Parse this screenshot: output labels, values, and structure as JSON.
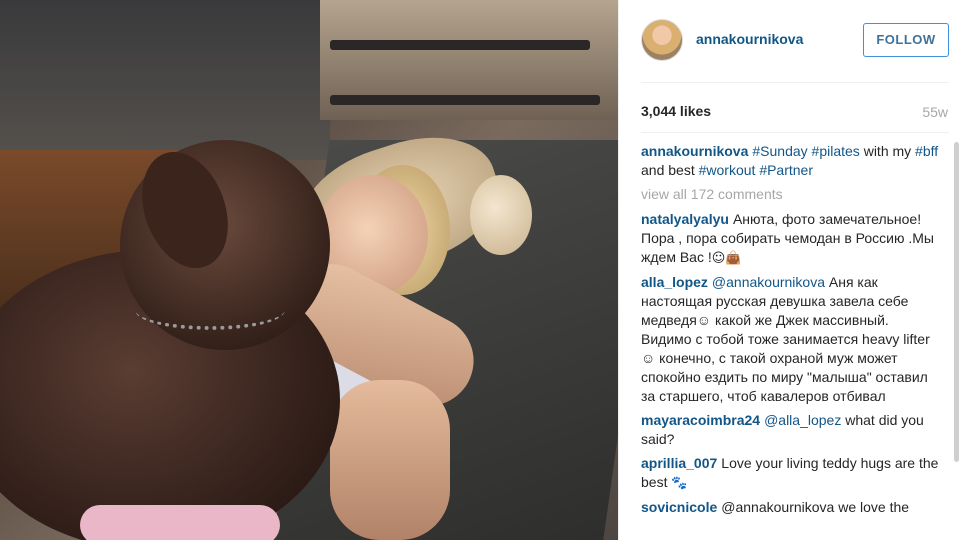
{
  "post": {
    "username": "annakournikova",
    "follow_label": "FOLLOW",
    "likes": "3,044 likes",
    "age": "55w",
    "caption": {
      "user": "annakournikova",
      "parts": [
        "#Sunday",
        " ",
        "#pilates",
        " with my ",
        "#bff",
        " and best ",
        "#workout",
        " ",
        "#Partner"
      ]
    },
    "view_all": "view all 172 comments"
  },
  "comments": [
    {
      "user": "natalyalyalyu",
      "text": "Анюта, фото замечательное! Пора , пора собирать чемодан в Россию .Мы ждем Вас !",
      "emoji": "☺👜"
    },
    {
      "user": "alla_lopez",
      "mention": "@annakournikova",
      "text": " Аня как настоящая русская девушка завела себе медведя☺ какой же Джек массивный. Видимо с тобой тоже занимается heavy lifter☺ конечно, с такой охраной муж может спокойно ездить по миру \"малыша\" оставил за старшего, чтоб кавалеров отбивал"
    },
    {
      "user": "mayaracoimbra24",
      "mention": "@alla_lopez",
      "text": " what did you said?"
    },
    {
      "user": "aprillia_007",
      "text": "Love your living teddy hugs are the best",
      "emoji": "🐾"
    },
    {
      "user": "sovicnicole",
      "text": "@annakournikova we love the"
    }
  ],
  "icons": {
    "avatar": "profile-photo",
    "photo": "post-photo"
  },
  "colors": {
    "link": "#125688",
    "follow_border": "#4090db",
    "muted": "#a5a7aa"
  }
}
